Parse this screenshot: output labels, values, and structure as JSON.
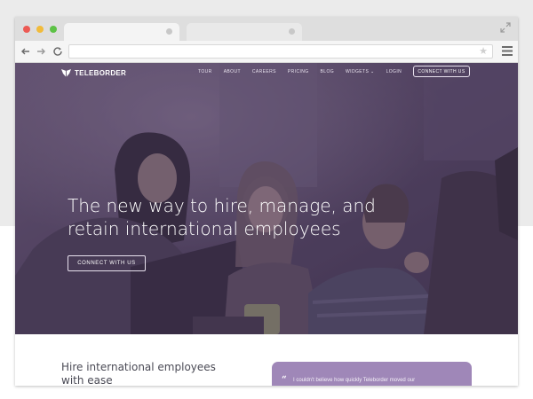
{
  "colors": {
    "hero_overlay": "#4a3c5c",
    "quote_card": "#9f87b8",
    "page_background": "#ebebeb"
  },
  "browser": {
    "window_controls": [
      "close",
      "minimize",
      "maximize"
    ],
    "toolbar_icons": [
      "back-arrow-icon",
      "forward-arrow-icon",
      "reload-icon",
      "star-icon",
      "hamburger-menu-icon"
    ]
  },
  "site": {
    "logo_text": "TELEBORDER",
    "nav": {
      "links": [
        "TOUR",
        "ABOUT",
        "CAREERS",
        "PRICING",
        "BLOG",
        "WIDGETS ⌄",
        "LOGIN"
      ],
      "cta_label": "CONNECT WITH US"
    },
    "hero": {
      "headline_line1": "The new way to hire, manage, and",
      "headline_line2": "retain international employees",
      "cta_label": "CONNECT WITH US"
    },
    "features": {
      "heading_line1": "Hire international employees",
      "heading_line2": "with ease"
    },
    "testimonial": {
      "quote_mark": "“",
      "quote_text": "I couldn't believe how quickly Teleborder moved our"
    }
  }
}
